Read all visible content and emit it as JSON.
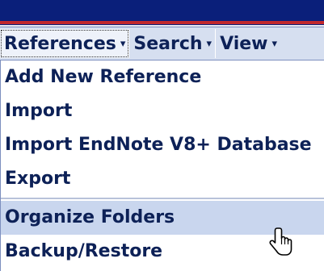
{
  "menubar": {
    "items": [
      {
        "label": "References",
        "arrow": "▾",
        "active": true
      },
      {
        "label": "Search",
        "arrow": "▾",
        "active": false
      },
      {
        "label": "View",
        "arrow": "▾",
        "active": false
      }
    ]
  },
  "dropdown": {
    "items": [
      {
        "label": "Add New Reference"
      },
      {
        "label": "Import"
      },
      {
        "label": "Import EndNote V8+ Database"
      },
      {
        "label": "Export"
      },
      {
        "label": "Organize Folders",
        "hovered": true
      },
      {
        "label": "Backup/Restore"
      }
    ]
  },
  "cursor": {
    "icon": "hand-pointer-icon"
  },
  "colors": {
    "accent_blue": "#0a1f7a",
    "accent_red": "#c0272d",
    "menubar_bg": "#d6dff0",
    "text": "#0d2157",
    "hover_bg": "#c9d6ee"
  }
}
